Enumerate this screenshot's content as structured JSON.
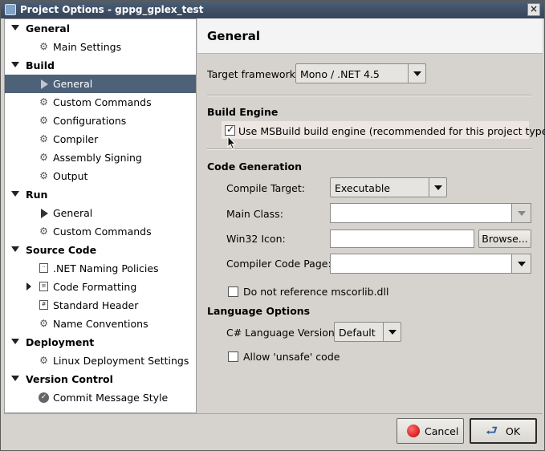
{
  "window": {
    "title": "Project Options - gppg_gplex_test",
    "close_glyph": "×"
  },
  "tree": {
    "rows": [
      {
        "type": "category",
        "label": "General"
      },
      {
        "type": "leaf",
        "icon": "gear-icon",
        "label": "Main Settings"
      },
      {
        "type": "category",
        "label": "Build"
      },
      {
        "type": "leaf",
        "icon": "play-icon",
        "label": "General",
        "selected": true
      },
      {
        "type": "leaf",
        "icon": "gear-icon",
        "label": "Custom Commands"
      },
      {
        "type": "leaf",
        "icon": "gear-icon",
        "label": "Configurations"
      },
      {
        "type": "leaf",
        "icon": "gear-icon",
        "label": "Compiler"
      },
      {
        "type": "leaf",
        "icon": "gear-icon",
        "label": "Assembly Signing"
      },
      {
        "type": "leaf",
        "icon": "gear-icon",
        "label": "Output"
      },
      {
        "type": "category",
        "label": "Run"
      },
      {
        "type": "leaf",
        "icon": "play-icon",
        "label": "General"
      },
      {
        "type": "leaf",
        "icon": "gear-icon",
        "label": "Custom Commands"
      },
      {
        "type": "category",
        "label": "Source Code"
      },
      {
        "type": "leaf",
        "icon": "naming-icon",
        "label": ".NET Naming Policies"
      },
      {
        "type": "leaf",
        "icon": "format-icon",
        "label": "Code Formatting",
        "collapsed": true
      },
      {
        "type": "leaf",
        "icon": "header-icon",
        "label": "Standard Header"
      },
      {
        "type": "leaf",
        "icon": "gear-icon",
        "label": "Name Conventions"
      },
      {
        "type": "category",
        "label": "Deployment"
      },
      {
        "type": "leaf",
        "icon": "gear-icon",
        "label": "Linux Deployment Settings"
      },
      {
        "type": "category",
        "label": "Version Control"
      },
      {
        "type": "leaf",
        "icon": "commit-icon",
        "label": "Commit Message Style"
      }
    ]
  },
  "panel": {
    "title": "General",
    "target_framework_label": "Target framework:",
    "target_framework_value": "Mono / .NET 4.5",
    "build_engine_section": "Build Engine",
    "msbuild_label": "Use MSBuild build engine (recommended for this project type)",
    "msbuild_checked": true,
    "code_generation_section": "Code Generation",
    "compile_target_label": "Compile Target:",
    "compile_target_value": "Executable",
    "main_class_label": "Main Class:",
    "main_class_value": "",
    "win32_icon_label": "Win32 Icon:",
    "win32_icon_value": "",
    "browse_label": "Browse...",
    "compiler_code_page_label": "Compiler Code Page:",
    "compiler_code_page_value": "",
    "mscorlib_label": "Do not reference mscorlib.dll",
    "mscorlib_checked": false,
    "language_options_section": "Language Options",
    "csharp_version_label": "C# Language Version:",
    "csharp_version_value": "Default",
    "unsafe_label": "Allow 'unsafe' code",
    "unsafe_checked": false
  },
  "buttons": {
    "cancel": "Cancel",
    "ok": "OK"
  }
}
